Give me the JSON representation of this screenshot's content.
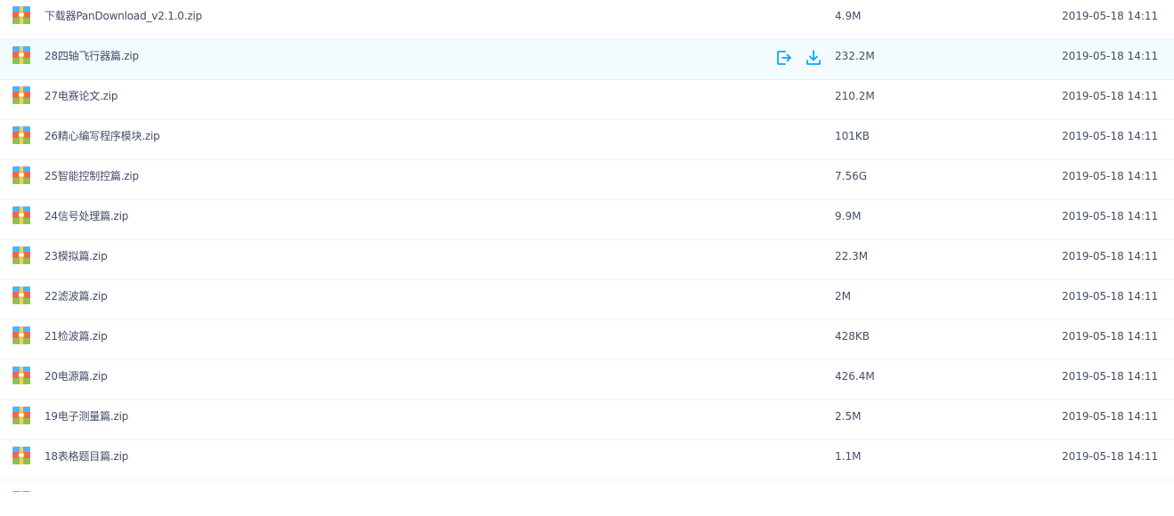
{
  "files": [
    {
      "name": "下载器PanDownload_v2.1.0.zip",
      "size": "4.9M",
      "date": "2019-05-18 14:11"
    },
    {
      "name": "28四轴飞行器篇.zip",
      "size": "232.2M",
      "date": "2019-05-18 14:11"
    },
    {
      "name": "27电赛论文.zip",
      "size": "210.2M",
      "date": "2019-05-18 14:11"
    },
    {
      "name": "26精心编写程序模块.zip",
      "size": "101KB",
      "date": "2019-05-18 14:11"
    },
    {
      "name": "25智能控制控篇.zip",
      "size": "7.56G",
      "date": "2019-05-18 14:11"
    },
    {
      "name": "24信号处理篇.zip",
      "size": "9.9M",
      "date": "2019-05-18 14:11"
    },
    {
      "name": "23模拟篇.zip",
      "size": "22.3M",
      "date": "2019-05-18 14:11"
    },
    {
      "name": "22滤波篇.zip",
      "size": "2M",
      "date": "2019-05-18 14:11"
    },
    {
      "name": "21检波篇.zip",
      "size": "428KB",
      "date": "2019-05-18 14:11"
    },
    {
      "name": "20电源篇.zip",
      "size": "426.4M",
      "date": "2019-05-18 14:11"
    },
    {
      "name": "19电子测量篇.zip",
      "size": "2.5M",
      "date": "2019-05-18 14:11"
    },
    {
      "name": "18表格题目篇.zip",
      "size": "1.1M",
      "date": "2019-05-18 14:11"
    }
  ],
  "hovered_row_actions": {
    "share_icon": "share-export-icon",
    "download_icon": "download-icon",
    "accent_color": "#06a7ff"
  },
  "icon": "zip-archive-icon",
  "colors": {
    "text": "#424e67",
    "row_divider": "#f1f3f8",
    "hover_bg": "#f4fbff",
    "accent": "#06a7ff"
  }
}
